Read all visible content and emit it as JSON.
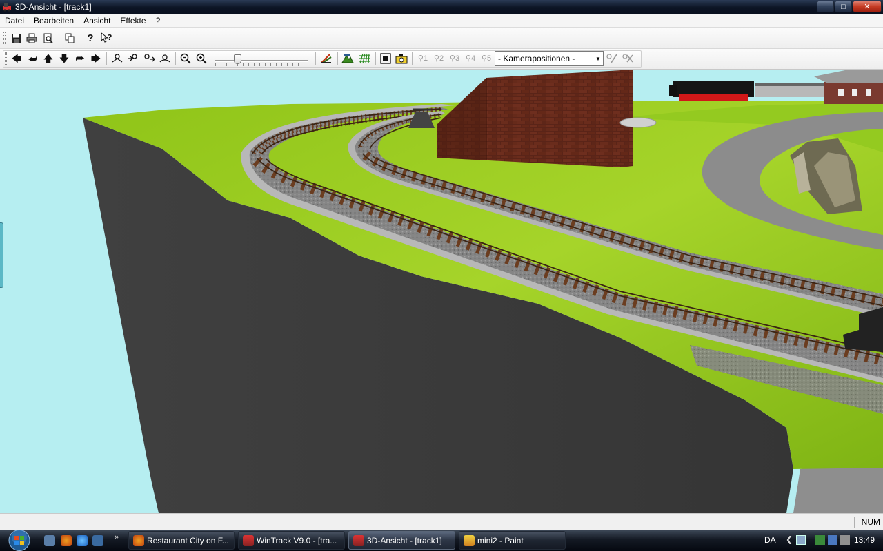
{
  "window": {
    "title": "3D-Ansicht - [track1]",
    "controls": {
      "minimize": "_",
      "maximize": "□",
      "close": "✕"
    }
  },
  "menu": [
    "Datei",
    "Bearbeiten",
    "Ansicht",
    "Effekte",
    "?"
  ],
  "toolbar1": {
    "icons": [
      "save-icon",
      "print-icon",
      "print-preview-icon",
      "copy-icon",
      "help-icon",
      "context-help-icon"
    ]
  },
  "toolbar2": {
    "nav_icons": [
      "arrow-left-icon",
      "arrow-back-icon",
      "arrow-up-icon",
      "arrow-down-icon",
      "arrow-forward-icon",
      "arrow-right-icon"
    ],
    "camera_icons": [
      "camera-move-icon",
      "camera-walk-icon",
      "camera-turn-icon",
      "camera-orbit-icon"
    ],
    "zoom_out": "zoom-out-icon",
    "zoom_in": "zoom-in-icon",
    "zoom_slider_level": 0.22,
    "camera_slots": [
      "1",
      "2",
      "3",
      "4",
      "5"
    ],
    "camera_position_select": "- Kamerapositionen -",
    "tool_icons": [
      "track-icon",
      "landscape-icon",
      "grid-icon",
      "fullscreen-icon",
      "snapshot-icon"
    ],
    "edit_icons": [
      "camera-edit-icon",
      "camera-delete-icon"
    ]
  },
  "status": {
    "num": "NUM"
  },
  "taskbar": {
    "tasks": [
      {
        "label": "Restaurant City on F...",
        "icon": "firefox-icon",
        "active": false
      },
      {
        "label": "WinTrack  V9.0 - [tra...",
        "icon": "wintrack-icon",
        "active": false
      },
      {
        "label": "3D-Ansicht - [track1]",
        "icon": "wintrack-3d-icon",
        "active": true
      },
      {
        "label": "mini2 - Paint",
        "icon": "paint-icon",
        "active": false
      }
    ],
    "quicklaunch_more": "»",
    "language": "DA",
    "tray_expand": "❮",
    "time": "13:49"
  },
  "colors": {
    "sky": "#b6eef1",
    "grass": "#9ccc20",
    "cliff": "#383838",
    "rail": "#6b3d20",
    "ballast": "#8a8a8a",
    "brick": "#5e2418"
  }
}
